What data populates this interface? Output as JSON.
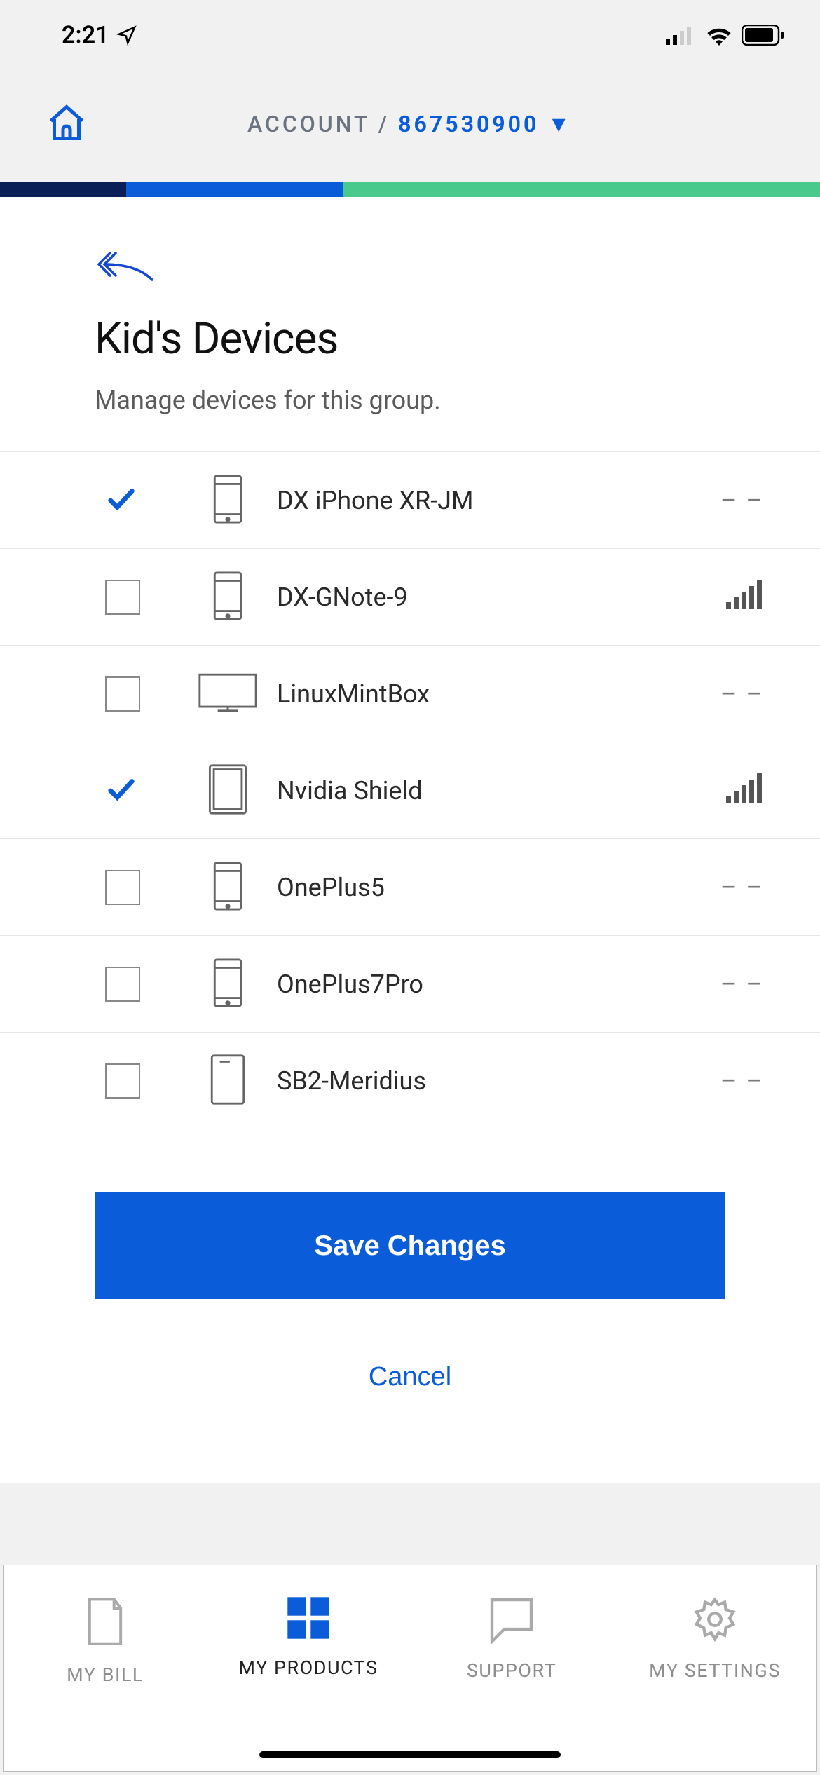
{
  "status": {
    "time": "2:21"
  },
  "header": {
    "label": "ACCOUNT",
    "account_number": "867530900"
  },
  "page": {
    "title": "Kid's Devices",
    "subtitle": "Manage devices for this group."
  },
  "devices": [
    {
      "name": "DX iPhone XR-JM",
      "selected": true,
      "icon": "phone",
      "signal": "none"
    },
    {
      "name": "DX-GNote-9",
      "selected": false,
      "icon": "phone",
      "signal": "bars"
    },
    {
      "name": "LinuxMintBox",
      "selected": false,
      "icon": "desktop",
      "signal": "none"
    },
    {
      "name": "Nvidia Shield",
      "selected": true,
      "icon": "tablet",
      "signal": "bars"
    },
    {
      "name": "OnePlus5",
      "selected": false,
      "icon": "phone",
      "signal": "none"
    },
    {
      "name": "OnePlus7Pro",
      "selected": false,
      "icon": "phone",
      "signal": "none"
    },
    {
      "name": "SB2-Meridius",
      "selected": false,
      "icon": "laptop",
      "signal": "none"
    }
  ],
  "actions": {
    "save": "Save Changes",
    "cancel": "Cancel"
  },
  "tabs": {
    "bill": "MY BILL",
    "products": "MY PRODUCTS",
    "support": "SUPPORT",
    "settings": "MY SETTINGS"
  }
}
